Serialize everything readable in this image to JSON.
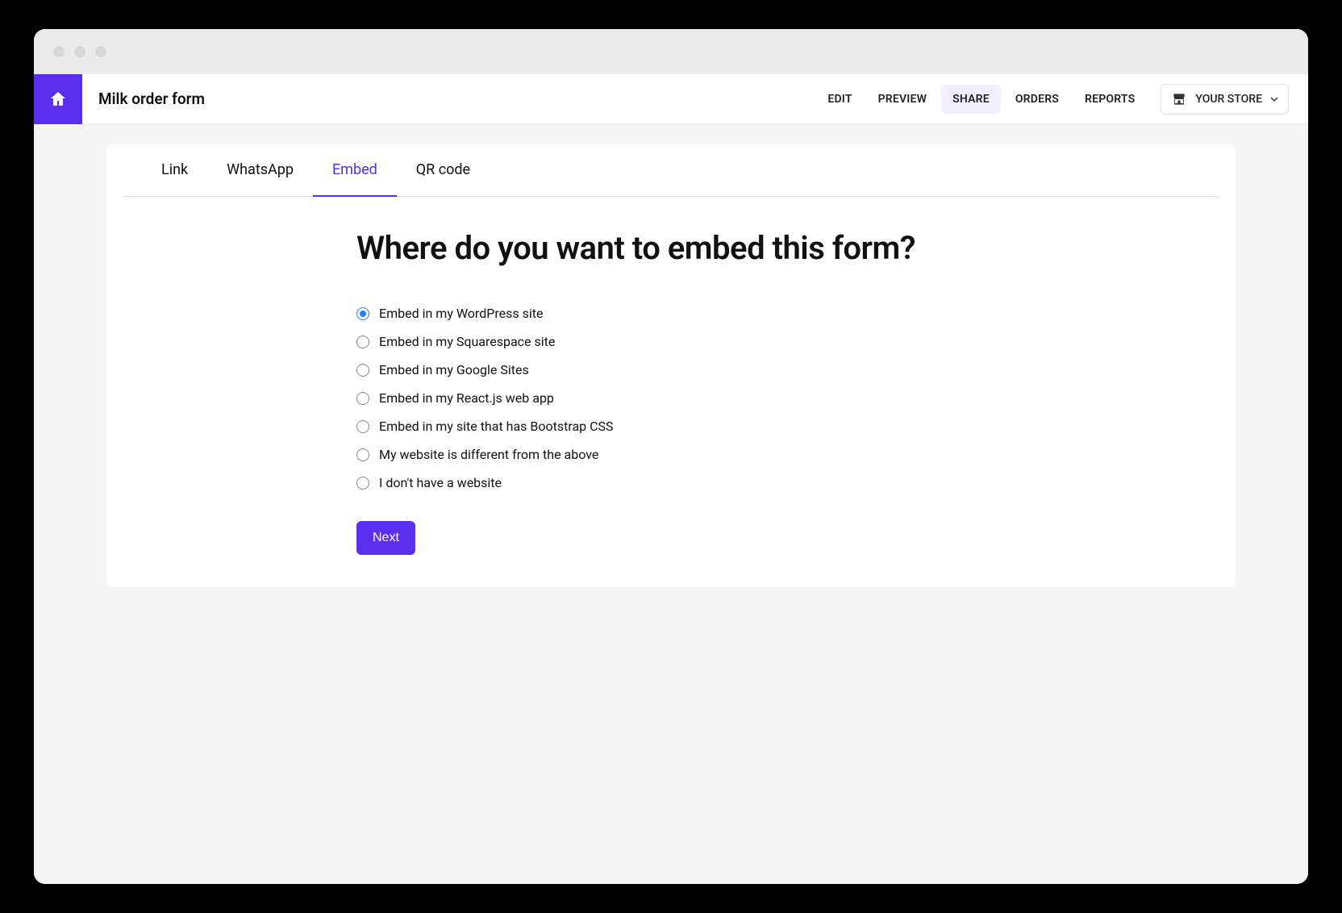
{
  "page_title": "Milk order form",
  "nav": {
    "edit": "EDIT",
    "preview": "PREVIEW",
    "share": "SHARE",
    "orders": "ORDERS",
    "reports": "REPORTS",
    "active": "share"
  },
  "store_button": "YOUR STORE",
  "tabs": {
    "link": "Link",
    "whatsapp": "WhatsApp",
    "embed": "Embed",
    "qrcode": "QR code",
    "active": "embed"
  },
  "heading": "Where do you want to embed this form?",
  "options": [
    {
      "label": "Embed in my WordPress site",
      "selected": true
    },
    {
      "label": "Embed in my Squarespace site",
      "selected": false
    },
    {
      "label": "Embed in my Google Sites",
      "selected": false
    },
    {
      "label": "Embed in my React.js web app",
      "selected": false
    },
    {
      "label": "Embed in my site that has Bootstrap CSS",
      "selected": false
    },
    {
      "label": "My website is different from the above",
      "selected": false
    },
    {
      "label": "I don't have a website",
      "selected": false
    }
  ],
  "next_label": "Next"
}
